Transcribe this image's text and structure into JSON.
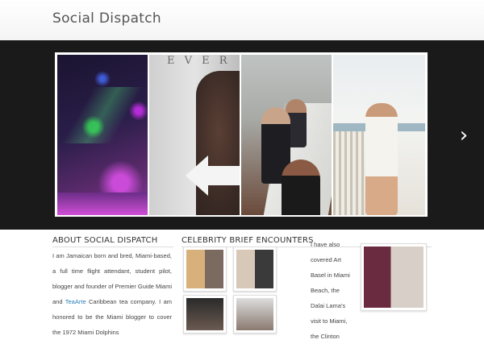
{
  "header": {
    "site_title": "Social Dispatch"
  },
  "slider": {
    "slide2_word": "E V E R",
    "next_icon": "chevron-right-icon",
    "next_glyph": "›"
  },
  "about": {
    "title": "ABOUT SOCIAL DISPATCH",
    "text_before_link": "I am Jamaican born and bred, Miami-based, a full time flight attendant, student pilot, blogger and founder of Premier Guide Miami and ",
    "link_text": "TeaArte",
    "text_after_link": " Caribbean tea company. I am honored to be the Miami blogger to cover the 1972 Miami Dolphins"
  },
  "celebrity": {
    "title": "CELEBRITY BRIEF ENCOUNTERS"
  },
  "art": {
    "text": "I have also covered Art Basel in Miami Beach, the Dalai Lama's visit to Miami, the Clinton"
  },
  "colors": {
    "link": "#2a7fb8",
    "slider_bg": "#1a1a1a"
  }
}
